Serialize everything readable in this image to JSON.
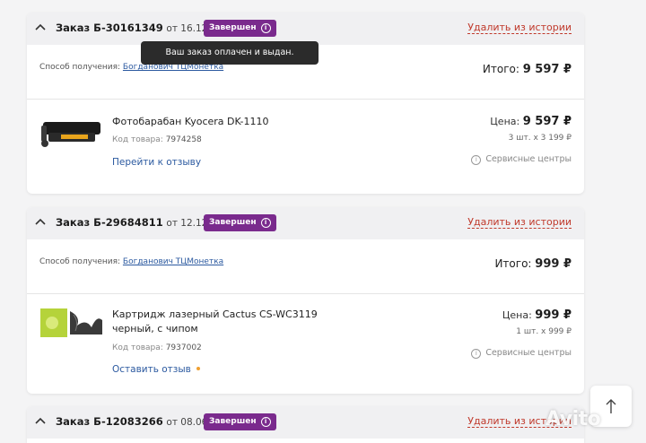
{
  "orders": [
    {
      "number": "Заказ Б-30161349",
      "date": "от 16.12.2020",
      "status": "Завершен",
      "remove": "Удалить из истории",
      "delivery_label": "Способ получения:",
      "delivery_point": "Богданович ТЦМонетка",
      "total_label": "Итого:",
      "total": "9 597 ₽",
      "product": {
        "name": "Фотобарабан Kyocera DK-1110",
        "code_label": "Код товара:",
        "code": "7974258",
        "action": "Перейти к отзыву",
        "price_label": "Цена:",
        "price": "9 597 ₽",
        "qty": "3 шт. х 3 199 ₽",
        "service": "Сервисные центры"
      }
    },
    {
      "number": "Заказ Б-29684811",
      "date": "от 12.12.2020",
      "status": "Завершен",
      "remove": "Удалить из истории",
      "delivery_label": "Способ получения:",
      "delivery_point": "Богданович ТЦМонетка",
      "total_label": "Итого:",
      "total": "999 ₽",
      "product": {
        "name": "Картридж лазерный Cactus CS-WC3119 черный, с чипом",
        "code_label": "Код товара:",
        "code": "7937002",
        "action": "Оставить отзыв",
        "price_label": "Цена:",
        "price": "999 ₽",
        "qty": "1 шт. х 999 ₽",
        "service": "Сервисные центры"
      }
    },
    {
      "number": "Заказ Б-12083266",
      "date": "от 08.06.2020",
      "status": "Завершен",
      "remove": "Удалить из истории"
    }
  ],
  "tooltip": "Ваш заказ оплачен и выдан.",
  "watermark": "Avito",
  "colors": {
    "status_badge": "#7a2a8d",
    "remove_link": "#c0392b",
    "link": "#2c5aa0",
    "tooltip_bg": "#2b2b2b"
  },
  "icons": {
    "collapse": "chevron-up-icon",
    "status_info": "info-icon",
    "service_info": "info-icon",
    "scroll_top": "arrow-up-icon"
  }
}
